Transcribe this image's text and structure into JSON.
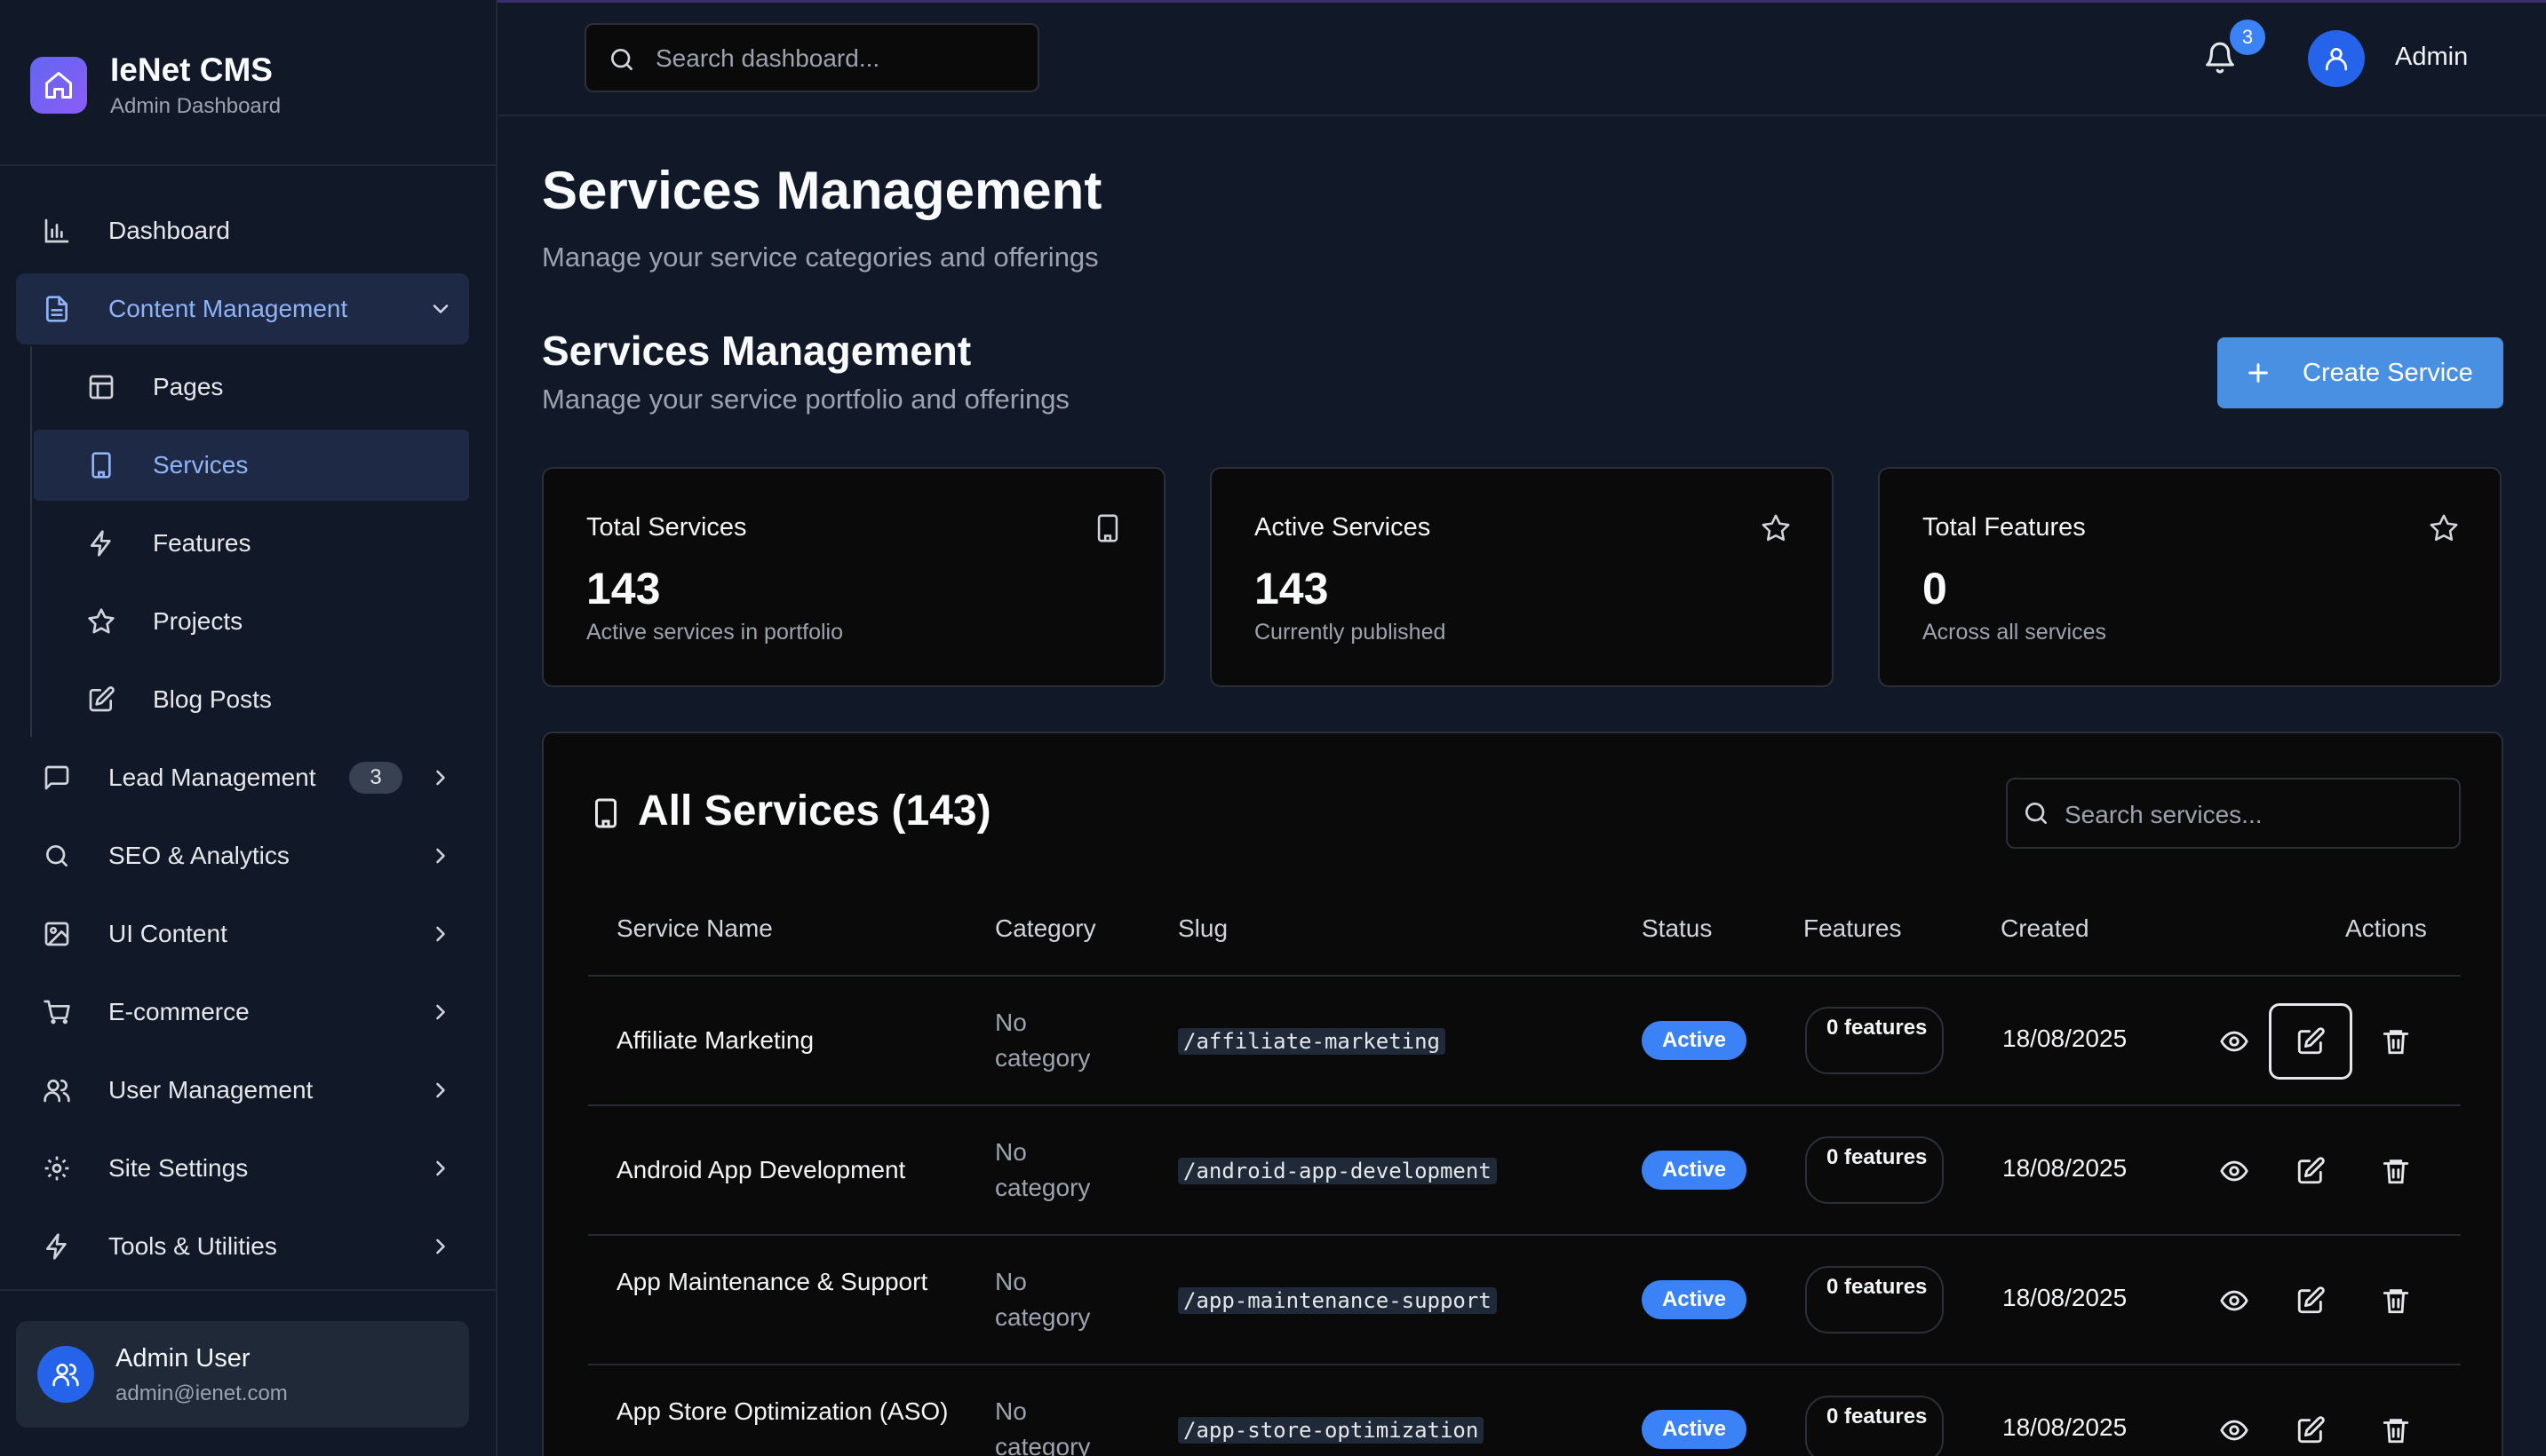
{
  "app": {
    "title": "IeNet CMS",
    "subtitle": "Admin Dashboard"
  },
  "sidebar": {
    "items": [
      {
        "label": "Dashboard",
        "icon": "bar-chart-icon"
      },
      {
        "label": "Content Management",
        "icon": "document-icon",
        "expanded": true
      },
      {
        "label": "Lead Management",
        "icon": "message-icon",
        "badge": "3"
      },
      {
        "label": "SEO & Analytics",
        "icon": "search-icon"
      },
      {
        "label": "UI Content",
        "icon": "image-icon"
      },
      {
        "label": "E-commerce",
        "icon": "cart-icon"
      },
      {
        "label": "User Management",
        "icon": "users-icon"
      },
      {
        "label": "Site Settings",
        "icon": "gear-icon"
      },
      {
        "label": "Tools & Utilities",
        "icon": "bolt-icon"
      }
    ],
    "content_sub": [
      {
        "label": "Pages",
        "icon": "layout-icon"
      },
      {
        "label": "Services",
        "icon": "building-icon",
        "active": true
      },
      {
        "label": "Features",
        "icon": "bolt-icon"
      },
      {
        "label": "Projects",
        "icon": "star-icon"
      },
      {
        "label": "Blog Posts",
        "icon": "edit-icon"
      }
    ],
    "user": {
      "name": "Admin User",
      "email": "admin@ienet.com"
    }
  },
  "topbar": {
    "search_placeholder": "Search dashboard...",
    "notifications": "3",
    "user_label": "Admin"
  },
  "page": {
    "title": "Services Management",
    "subtitle": "Manage your service categories and offerings",
    "section_title": "Services Management",
    "section_subtitle": "Manage your service portfolio and offerings",
    "create_button": "Create Service"
  },
  "stats": [
    {
      "title": "Total Services",
      "value": "143",
      "desc": "Active services in portfolio",
      "icon": "building-icon"
    },
    {
      "title": "Active Services",
      "value": "143",
      "desc": "Currently published",
      "icon": "star-icon"
    },
    {
      "title": "Total Features",
      "value": "0",
      "desc": "Across all services",
      "icon": "star-icon"
    }
  ],
  "table": {
    "title": "All Services (143)",
    "search_placeholder": "Search services...",
    "columns": [
      "Service Name",
      "Category",
      "Slug",
      "Status",
      "Features",
      "Created",
      "Actions"
    ],
    "rows": [
      {
        "name": "Affiliate Marketing",
        "category": "No category",
        "slug": "/affiliate-marketing",
        "status": "Active",
        "features": "0 features",
        "created": "18/08/2025"
      },
      {
        "name": "Android App Development",
        "category": "No category",
        "slug": "/android-app-development",
        "status": "Active",
        "features": "0 features",
        "created": "18/08/2025"
      },
      {
        "name": "App Maintenance & Support",
        "category": "No category",
        "slug": "/app-maintenance-support",
        "status": "Active",
        "features": "0 features",
        "created": "18/08/2025"
      },
      {
        "name": "App Store Optimization (ASO)",
        "category": "No category",
        "slug": "/app-store-optimization",
        "status": "Active",
        "features": "0 features",
        "created": "18/08/2025"
      }
    ]
  },
  "colors": {
    "accent": "#3b82f6",
    "background": "#111827",
    "card": "#0a0a0a",
    "active_nav": "#1e2a45"
  }
}
